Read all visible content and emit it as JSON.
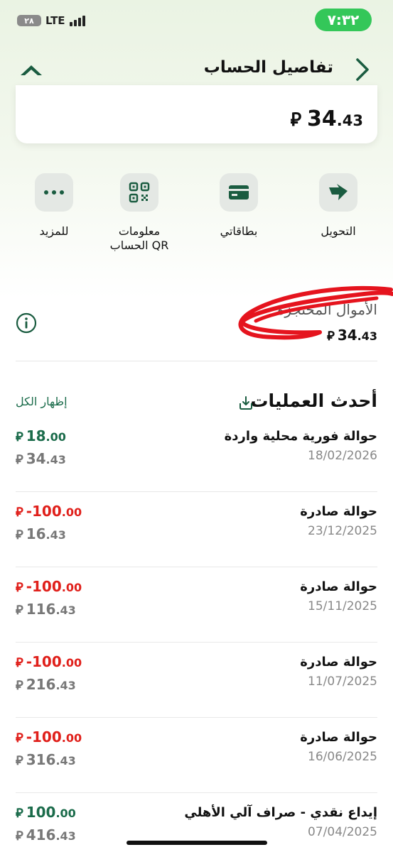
{
  "status_bar": {
    "time": "٧:٣٢",
    "network": "LTE",
    "battery": "٢٨"
  },
  "header": {
    "title": "تفاصيل الحساب"
  },
  "balance_card": {
    "amount_int": "34",
    "amount_dec": ".43",
    "currency_symbol": "⃁"
  },
  "actions": [
    {
      "label": "التحويل",
      "icon": "transfer-icon"
    },
    {
      "label": "بطاقاتي",
      "icon": "card-icon"
    },
    {
      "label": "معلومات الحساب QR",
      "icon": "qr-icon"
    },
    {
      "label": "للمزيد",
      "icon": "more-icon"
    }
  ],
  "reserved": {
    "label": "الأموال المحتجزة",
    "amount_int": "34",
    "amount_dec": ".43"
  },
  "transactions_section": {
    "title": "أحدث العمليات",
    "show_all": "إظهار الكل"
  },
  "transactions": [
    {
      "name": "حوالة فورية محلية واردة",
      "date": "18/02/2026",
      "amount_int": "18",
      "amount_dec": ".00",
      "balance_int": "34",
      "balance_dec": ".43",
      "type": "credit"
    },
    {
      "name": "حوالة صادرة",
      "date": "23/12/2025",
      "amount_int": "-100",
      "amount_dec": ".00",
      "balance_int": "16",
      "balance_dec": ".43",
      "type": "debit"
    },
    {
      "name": "حوالة صادرة",
      "date": "15/11/2025",
      "amount_int": "-100",
      "amount_dec": ".00",
      "balance_int": "116",
      "balance_dec": ".43",
      "type": "debit"
    },
    {
      "name": "حوالة صادرة",
      "date": "11/07/2025",
      "amount_int": "-100",
      "amount_dec": ".00",
      "balance_int": "216",
      "balance_dec": ".43",
      "type": "debit"
    },
    {
      "name": "حوالة صادرة",
      "date": "16/06/2025",
      "amount_int": "-100",
      "amount_dec": ".00",
      "balance_int": "316",
      "balance_dec": ".43",
      "type": "debit"
    },
    {
      "name": "إيداع نقدي - صراف آلي الأهلي",
      "date": "07/04/2025",
      "amount_int": "100",
      "amount_dec": ".00",
      "balance_int": "416",
      "balance_dec": ".43",
      "type": "credit"
    }
  ],
  "colors": {
    "accent_green": "#1a6b4a",
    "credit_green": "#1a6b4a",
    "debit_red": "#e0201b",
    "status_green": "#34c759",
    "annotation_red": "#e5141e"
  }
}
